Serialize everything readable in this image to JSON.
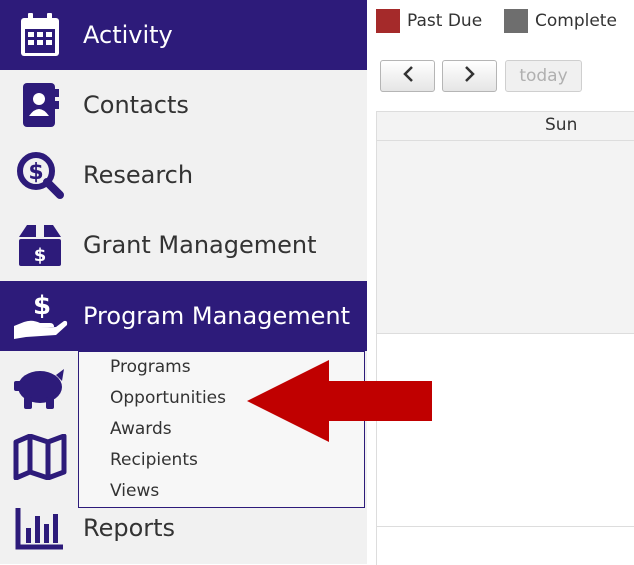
{
  "sidebar": {
    "items": [
      {
        "label": "Activity",
        "icon": "calendar-icon",
        "active": true
      },
      {
        "label": "Contacts",
        "icon": "contact-book-icon",
        "active": false
      },
      {
        "label": "Research",
        "icon": "search-dollar-icon",
        "active": false
      },
      {
        "label": "Grant Management",
        "icon": "money-box-icon",
        "active": false
      },
      {
        "label": "Program Management",
        "icon": "hand-dollar-icon",
        "active": true
      },
      {
        "label": "Reports",
        "icon": "bar-chart-icon",
        "active": false
      }
    ],
    "hidden_icons": [
      "piggy-bank-icon",
      "map-icon"
    ],
    "submenu": [
      "Programs",
      "Opportunities",
      "Awards",
      "Recipients",
      "Views"
    ]
  },
  "calendar": {
    "legend": [
      {
        "label": "Past Due",
        "color": "#a52a2a"
      },
      {
        "label": "Complete",
        "color": "#6e6e6e"
      }
    ],
    "toolbar": {
      "prev": "<",
      "next": ">",
      "today": "today"
    },
    "day_header": "Sun"
  },
  "colors": {
    "brand": "#2d1b7a",
    "arrow": "#c00000"
  }
}
